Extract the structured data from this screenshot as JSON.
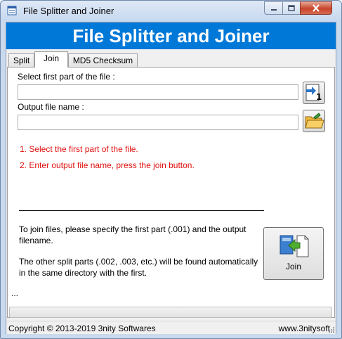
{
  "window": {
    "title": "File Splitter and Joiner",
    "controls": {
      "minimize_icon": "minimize-icon",
      "maximize_icon": "maximize-icon",
      "close_icon": "close-icon"
    }
  },
  "banner": {
    "text": "File Splitter and Joiner",
    "color": "#0078d7"
  },
  "tabs": [
    {
      "label": "Split",
      "active": false
    },
    {
      "label": "Join",
      "active": true
    },
    {
      "label": "MD5 Checksum",
      "active": false
    }
  ],
  "join": {
    "first_part_label": "Select first part of the file :",
    "first_part_value": "",
    "browse_first_icon": "open-part-file-icon",
    "output_label": "Output file name :",
    "output_value": "",
    "browse_output_icon": "save-folder-icon",
    "steps": [
      "1. Select the first part of the file.",
      "2. Enter output file name, press the join button."
    ],
    "step_color": "#e01010",
    "help_1": "To join files, please specify the first part (.001) and the output filename.",
    "help_2": "The other split parts (.002, .003, etc.) will be found automatically in the same directory with the first.",
    "join_button_label": "Join",
    "join_button_icon": "join-files-icon"
  },
  "status_text": "...",
  "progress": {
    "value_percent": 0
  },
  "statusbar": {
    "copyright": "Copyright © 2013-2019 3nity Softwares",
    "website": "www.3nitysoft"
  }
}
